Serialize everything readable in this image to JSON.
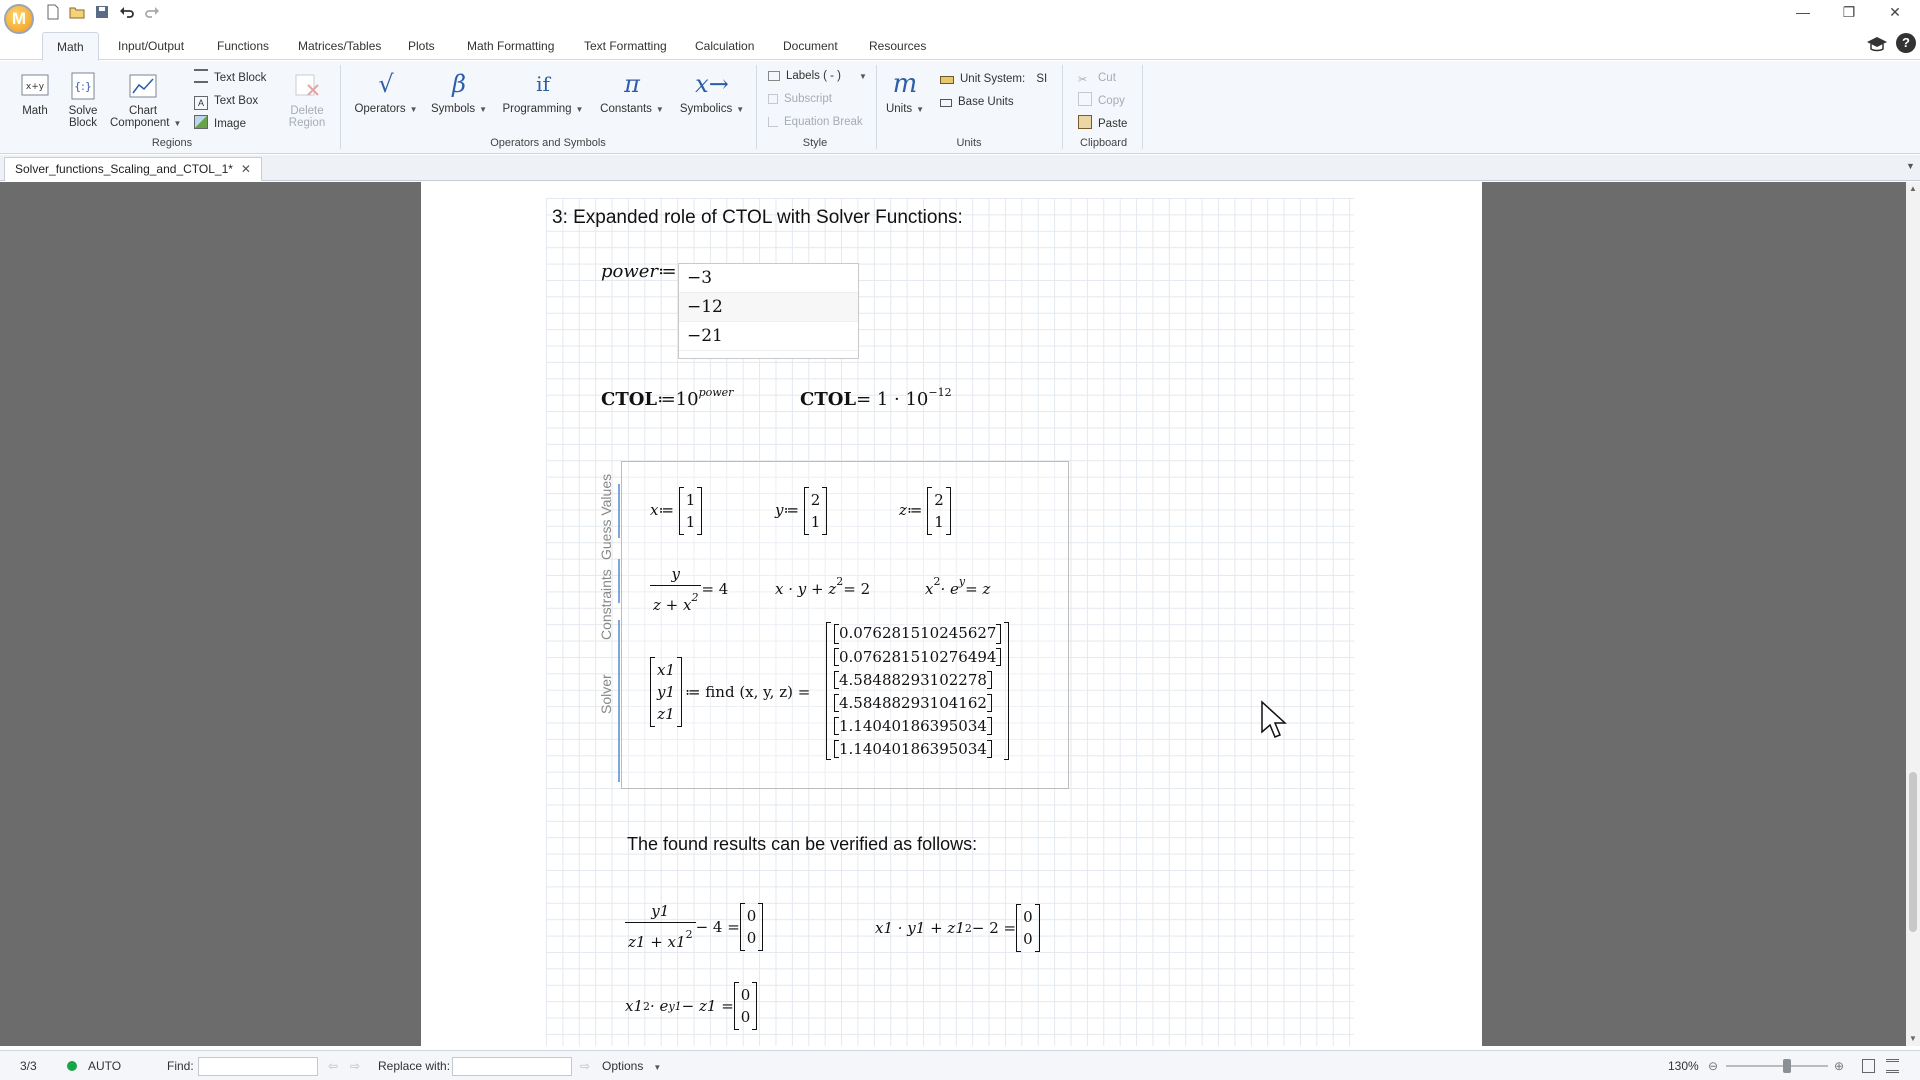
{
  "app": {
    "logo_letter": "M"
  },
  "window": {
    "minimize": "—",
    "restore": "❐",
    "close": "✕"
  },
  "menu_tabs": [
    {
      "label": "Math"
    },
    {
      "label": "Input/Output"
    },
    {
      "label": "Functions"
    },
    {
      "label": "Matrices/Tables"
    },
    {
      "label": "Plots"
    },
    {
      "label": "Math Formatting"
    },
    {
      "label": "Text Formatting"
    },
    {
      "label": "Calculation"
    },
    {
      "label": "Document"
    },
    {
      "label": "Resources"
    }
  ],
  "ribbon": {
    "regions": {
      "math": "Math",
      "solve_block_1": "Solve",
      "solve_block_2": "Block",
      "chart_1": "Chart",
      "chart_2": "Component",
      "text_block": "Text Block",
      "text_box": "Text Box",
      "image": "Image",
      "delete_1": "Delete",
      "delete_2": "Region",
      "group": "Regions"
    },
    "operators": {
      "operators": "Operators",
      "symbols": "Symbols",
      "programming": "Programming",
      "constants": "Constants",
      "symbolics": "Symbolics",
      "group": "Operators and Symbols",
      "operators_glyph": "√",
      "symbols_glyph": "β",
      "programming_glyph": "if",
      "constants_glyph": "π",
      "symbolics_glyph": "x→"
    },
    "style": {
      "labels": "Labels",
      "labels_value": "( - )",
      "subscript": "Subscript",
      "equation_break": "Equation Break",
      "group": "Style"
    },
    "units": {
      "units": "Units",
      "units_glyph": "m",
      "unit_system": "Unit System:",
      "unit_system_value": "SI",
      "base_units": "Base Units",
      "group": "Units"
    },
    "clipboard": {
      "cut": "Cut",
      "copy": "Copy",
      "paste": "Paste",
      "group": "Clipboard"
    }
  },
  "document_tab": {
    "label": "Solver_functions_Scaling_and_CTOL_1*",
    "close": "✕"
  },
  "worksheet": {
    "heading": "3: Expanded role of CTOL with Solver Functions:",
    "power_name": "power",
    "assign": "≔",
    "power_values": [
      "−3",
      "−12",
      "−21"
    ],
    "ctol_def_lhs": "CTOL",
    "ctol_def_base": "10",
    "ctol_def_exp": "power",
    "ctol_result_lhs": "CTOL",
    "ctol_result_rhs": "= 1 · 10",
    "ctol_result_exp": "−12",
    "solve_labels": {
      "guess": "Guess Values",
      "constraints": "Constraints",
      "solver": "Solver"
    },
    "guess": [
      {
        "var": "x",
        "values": [
          "1",
          "1"
        ]
      },
      {
        "var": "y",
        "values": [
          "2",
          "1"
        ]
      },
      {
        "var": "z",
        "values": [
          "2",
          "1"
        ]
      }
    ],
    "constraints": {
      "c1_num": "y",
      "c1_den": "z + x",
      "c1_den_exp": "2",
      "c1_rhs": "= 4",
      "c2": "x · y + z",
      "c2_exp": "2",
      "c2_rhs": "= 2",
      "c3_a": "x",
      "c3_a_exp": "2",
      "c3_b": "· e",
      "c3_b_exp": "y",
      "c3_rhs": "= z"
    },
    "solver": {
      "lhs": [
        "x1",
        "y1",
        "z1"
      ],
      "call": "≔ find (x, y, z) =",
      "results": [
        "0.076281510245627",
        "0.076281510276494",
        "4.58488293102278",
        "4.58488293104162",
        "1.14040186395034",
        "1.14040186395034"
      ]
    },
    "verify_text": "The found results can be verified as follows:",
    "verify": {
      "v1_num": "y1",
      "v1_den": "z1 + x1",
      "v1_den_exp": "2",
      "v1_tail": "− 4 =",
      "v1_values": [
        "0",
        "0"
      ],
      "v2": "x1 · y1 + z1",
      "v2_exp": "2",
      "v2_tail": "− 2 =",
      "v2_values": [
        "0",
        "0"
      ],
      "v3_a": "x1",
      "v3_a_exp": "2",
      "v3_b": "· e",
      "v3_b_exp": "y1",
      "v3_tail": "− z1 =",
      "v3_values": [
        "0",
        "0"
      ]
    }
  },
  "statusbar": {
    "page": "3/3",
    "calc_mode": "AUTO",
    "find_label": "Find:",
    "replace_label": "Replace with:",
    "options": "Options",
    "zoom": "130%",
    "zoom_level": 0.6
  },
  "colors": {
    "accent": "#2d5da8",
    "status_green": "#1aa34a",
    "workspace": "#6c6c6c"
  }
}
